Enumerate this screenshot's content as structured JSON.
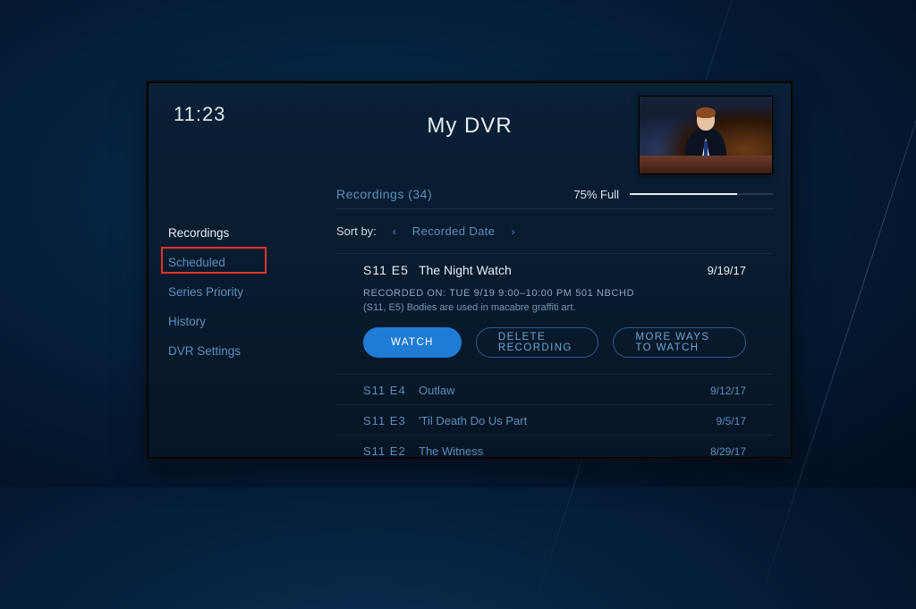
{
  "clock": "11:23",
  "title": "My DVR",
  "section": {
    "label": "Recordings (34)"
  },
  "storage": {
    "label": "75% Full",
    "percent": 75
  },
  "sort": {
    "label": "Sort by:",
    "value": "Recorded Date"
  },
  "sidebar": {
    "items": [
      {
        "label": "Recordings",
        "active": true
      },
      {
        "label": "Scheduled"
      },
      {
        "label": "Series Priority"
      },
      {
        "label": "History"
      },
      {
        "label": "DVR Settings"
      }
    ],
    "highlighted_index": 1
  },
  "expanded": {
    "ep": "S11 E5",
    "name": "The Night Watch",
    "date": "9/19/17",
    "recorded_line": "RECORDED ON: TUE 9/19   9:00–10:00 PM    501 NBCHD",
    "desc": "(S11, E5) Bodies are used in macabre graffiti art.",
    "actions": {
      "watch": "WATCH",
      "delete": "DELETE RECORDING",
      "more": "MORE WAYS TO WATCH"
    }
  },
  "rows": [
    {
      "ep": "S11 E4",
      "name": "Outlaw",
      "date": "9/12/17"
    },
    {
      "ep": "S11 E3",
      "name": "'Til Death Do Us Part",
      "date": "9/5/17"
    },
    {
      "ep": "S11 E2",
      "name": "The Witness",
      "date": "8/29/17"
    }
  ],
  "colors": {
    "accent": "#1f7bd4",
    "link": "#5c8fbd",
    "highlight_box": "#e33528"
  }
}
